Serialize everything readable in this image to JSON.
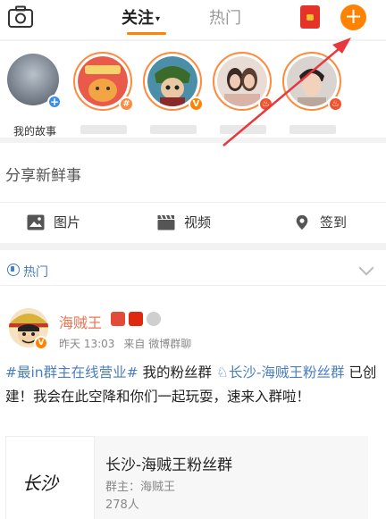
{
  "header": {
    "tab_follow": "关注",
    "tab_follow_caret": "▾",
    "tab_hot": "热门",
    "add_label": "+"
  },
  "stories": {
    "my_story_label": "我的故事",
    "items": [
      {
        "badge": "#",
        "badge_color": "#ff8a3d"
      },
      {
        "badge": "V",
        "badge_color": "#ff8200"
      },
      {
        "badge": "♨",
        "badge_color": "#f0522e"
      },
      {
        "badge": "♨",
        "badge_color": "#f0522e"
      }
    ]
  },
  "composer": {
    "placeholder": "分享新鲜事",
    "actions": [
      {
        "label": "图片"
      },
      {
        "label": "视频"
      },
      {
        "label": "签到"
      }
    ]
  },
  "hot": {
    "label": "热门"
  },
  "post": {
    "author": "海贼王",
    "avatar_badge": "V",
    "time": "昨天 13:03",
    "source": "来自 微博群聊",
    "text_link1": "#最in群主在线营业#",
    "text_part1": " 我的粉丝群 ",
    "text_link2": "♘长沙-海贼王粉丝群",
    "text_part2": " 已创建！我会在此空降和你们一起玩耍，速来入群啦！",
    "card": {
      "logo_text": "长沙",
      "title": "长沙-海贼王粉丝群",
      "owner": "群主：海贼王",
      "count": "278人"
    }
  },
  "colors": {
    "accent": "#ff8200",
    "link": "#4a7ec2",
    "author": "#eb7350",
    "annotation_arrow": "#e8383d"
  }
}
